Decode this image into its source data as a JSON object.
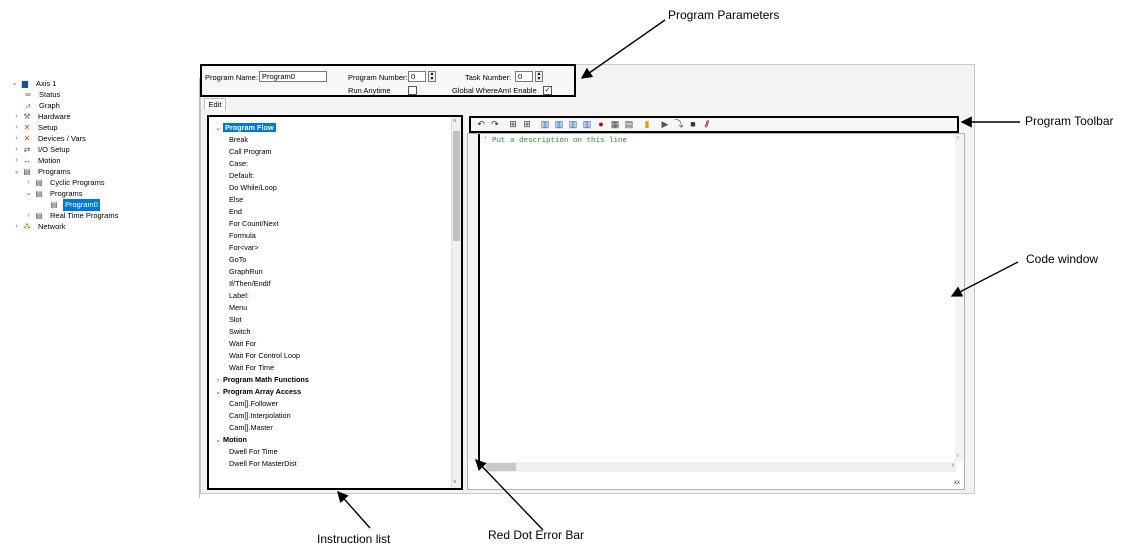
{
  "callouts": {
    "program_parameters": "Program Parameters",
    "program_toolbar": "Program Toolbar",
    "code_window": "Code window",
    "instruction_list": "Instruction list",
    "red_dot_error_bar": "Red Dot Error Bar"
  },
  "nav_tree": {
    "items": [
      {
        "label": "Axis 1",
        "icon": "axis-icon"
      },
      {
        "label": "Status",
        "icon": "status-icon"
      },
      {
        "label": "Graph",
        "icon": "graph-icon"
      },
      {
        "label": "Hardware",
        "icon": "hardware-icon"
      },
      {
        "label": "Setup",
        "icon": "setup-icon"
      },
      {
        "label": "Devices / Vars",
        "icon": "devices-icon"
      },
      {
        "label": "I/O Setup",
        "icon": "io-icon"
      },
      {
        "label": "Motion",
        "icon": "motion-icon"
      },
      {
        "label": "Programs",
        "icon": "programs-icon"
      },
      {
        "label": "Cyclic Programs",
        "icon": "cyclic-programs-icon"
      },
      {
        "label": "Programs",
        "icon": "programs-folder-icon"
      },
      {
        "label": "Program0",
        "icon": "program-file-icon"
      },
      {
        "label": "Real Time Programs",
        "icon": "real-time-programs-icon"
      },
      {
        "label": "Network",
        "icon": "network-icon"
      }
    ]
  },
  "params": {
    "program_name_label": "Program Name:",
    "program_name_value": "Program0",
    "program_number_label": "Program Number:",
    "program_number_value": "0",
    "task_number_label": "Task Number:",
    "task_number_value": "0",
    "run_anytime_label": "Run Anytime",
    "run_anytime_checked": false,
    "global_whereami_label": "Global WhereAmI Enable",
    "global_whereami_checked": true
  },
  "tabs": {
    "edit": "Edit"
  },
  "instruction_list": {
    "rows": [
      {
        "label": "Program Flow",
        "type": "category",
        "expanded": true,
        "selected": true
      },
      {
        "label": "Break"
      },
      {
        "label": "Call Program"
      },
      {
        "label": "Case:"
      },
      {
        "label": "Default:"
      },
      {
        "label": "Do While/Loop"
      },
      {
        "label": "Else"
      },
      {
        "label": "End"
      },
      {
        "label": "For Count/Next"
      },
      {
        "label": "Formula"
      },
      {
        "label": "For<var>"
      },
      {
        "label": "GoTo"
      },
      {
        "label": "GraphRun"
      },
      {
        "label": "If/Then/EndIf"
      },
      {
        "label": "Label:"
      },
      {
        "label": "Menu"
      },
      {
        "label": "Slot"
      },
      {
        "label": "Switch"
      },
      {
        "label": "Wait For"
      },
      {
        "label": "Wait For Control Loop"
      },
      {
        "label": "Wait For Time"
      },
      {
        "label": "Program Math Functions",
        "type": "category",
        "expanded": false
      },
      {
        "label": "Program Array Access",
        "type": "category",
        "expanded": true
      },
      {
        "label": "Cam[].Follower"
      },
      {
        "label": "Cam[].Interpolation"
      },
      {
        "label": "Cam[].Master"
      },
      {
        "label": "Motion",
        "type": "category",
        "expanded": true
      },
      {
        "label": "Dwell For Time"
      },
      {
        "label": "Dwell For MasterDist"
      }
    ]
  },
  "toolbar": {
    "icons": [
      "undo-icon",
      "redo-icon",
      "find-icon",
      "find-next-icon",
      "chart-icon-1",
      "chart-icon-2",
      "chart-icon-3",
      "chart-icon-4",
      "help-icon",
      "grid-icon",
      "calculator-icon",
      "lock-icon",
      "run-icon",
      "step-icon",
      "stop-icon",
      "clear-breakpoints-icon"
    ]
  },
  "code": {
    "line_1": "' Put a description on this line",
    "status_text": "xx"
  },
  "colors": {
    "selection": "#0078d7",
    "comment": "#2e8b2e",
    "help_icon": "#d00000"
  }
}
